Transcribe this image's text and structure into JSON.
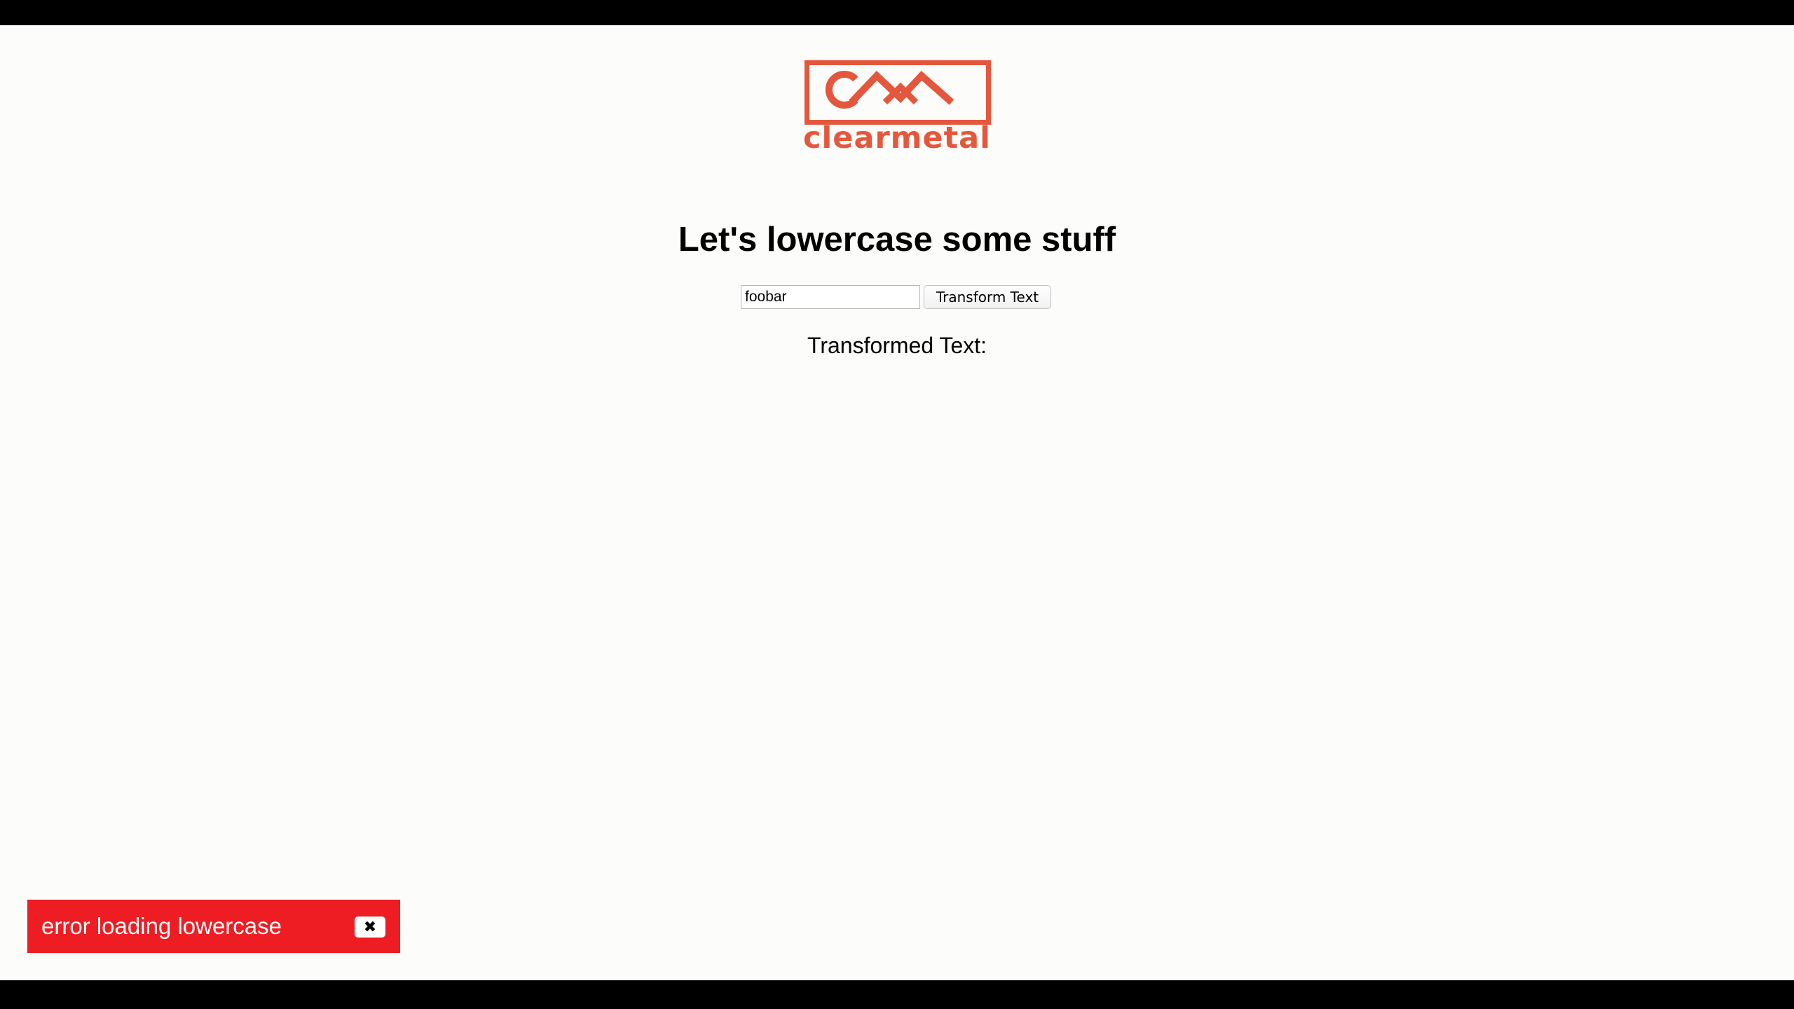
{
  "brand": {
    "name": "clearmetal",
    "color": "#e4573d",
    "icon": "clearmetal-cm-mark-icon"
  },
  "main": {
    "heading": "Let's lowercase some stuff",
    "input_value": "foobar",
    "button_label": "Transform Text",
    "result_label": "Transformed Text:"
  },
  "toast": {
    "message": "error loading lowercase",
    "close_icon": "✖",
    "background_color": "#ee1d23"
  }
}
